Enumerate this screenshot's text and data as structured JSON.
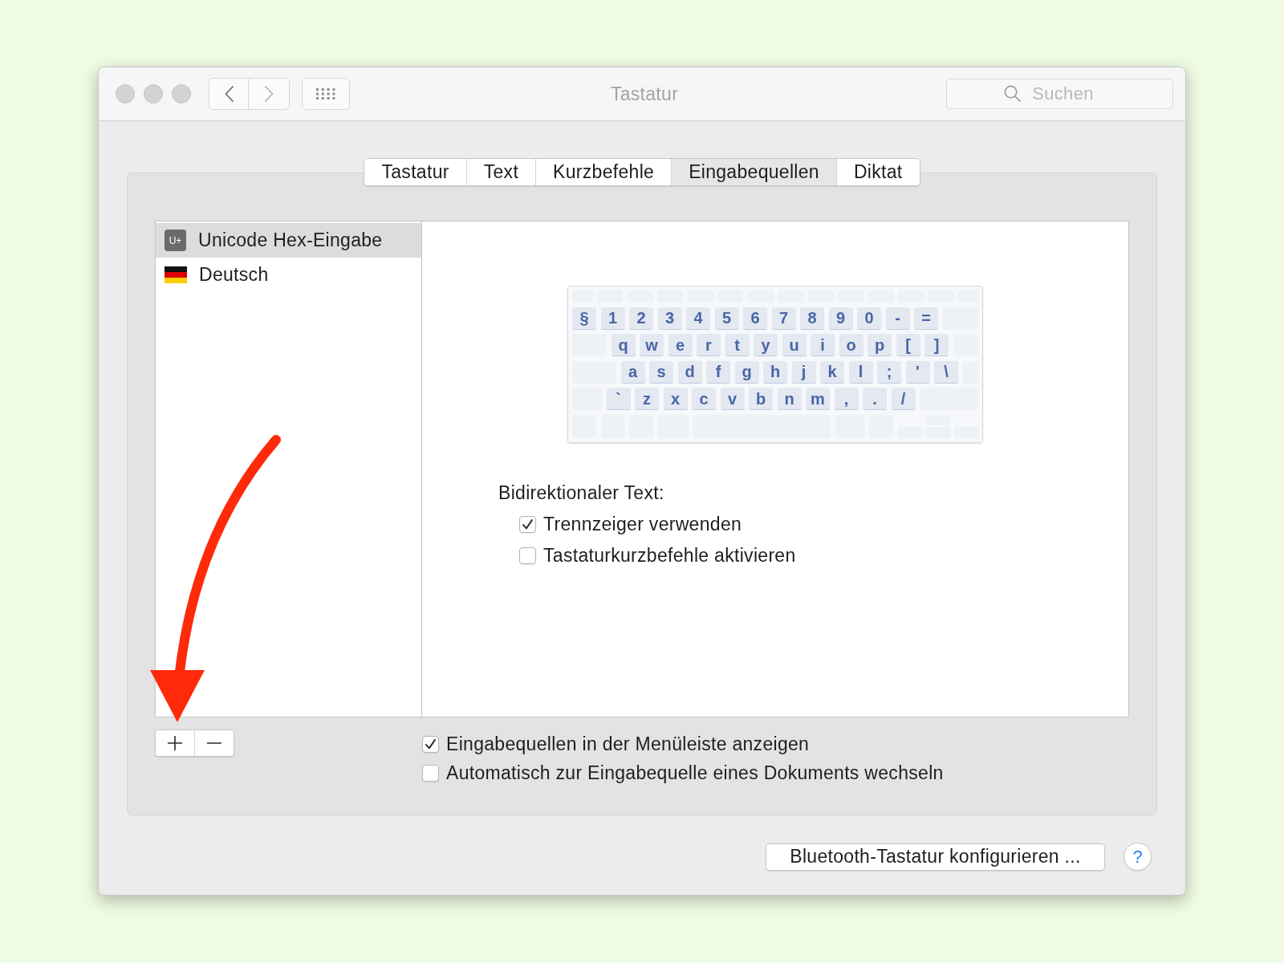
{
  "window": {
    "title": "Tastatur"
  },
  "search": {
    "placeholder": "Suchen"
  },
  "tabs": [
    {
      "label": "Tastatur",
      "selected": false
    },
    {
      "label": "Text",
      "selected": false
    },
    {
      "label": "Kurzbefehle",
      "selected": false
    },
    {
      "label": "Eingabequellen",
      "selected": true
    },
    {
      "label": "Diktat",
      "selected": false
    }
  ],
  "input_sources": [
    {
      "name": "Unicode Hex-Eingabe",
      "kind": "badge",
      "badge": "U+",
      "selected": true
    },
    {
      "name": "Deutsch",
      "kind": "flag",
      "selected": false
    }
  ],
  "keyboard": {
    "rows": [
      [
        "§",
        "1",
        "2",
        "3",
        "4",
        "5",
        "6",
        "7",
        "8",
        "9",
        "0",
        "-",
        "="
      ],
      [
        "q",
        "w",
        "e",
        "r",
        "t",
        "y",
        "u",
        "i",
        "o",
        "p",
        "[",
        "]"
      ],
      [
        "a",
        "s",
        "d",
        "f",
        "g",
        "h",
        "j",
        "k",
        "l",
        ";",
        "'",
        "\\"
      ],
      [
        "`",
        "z",
        "x",
        "c",
        "v",
        "b",
        "n",
        "m",
        ",",
        ".",
        "/"
      ]
    ]
  },
  "bidi": {
    "heading": "Bidirektionaler Text:",
    "options": [
      {
        "label": "Trennzeiger verwenden",
        "checked": true
      },
      {
        "label": "Tastaturkurzbefehle aktivieren",
        "checked": false
      }
    ]
  },
  "options": [
    {
      "label": "Eingabequellen in der Menüleiste anzeigen",
      "checked": true
    },
    {
      "label": "Automatisch zur Eingabequelle eines Dokuments wechseln",
      "checked": false
    }
  ],
  "footer": {
    "button": "Bluetooth-Tastatur konfigurieren ...",
    "help": "?"
  }
}
